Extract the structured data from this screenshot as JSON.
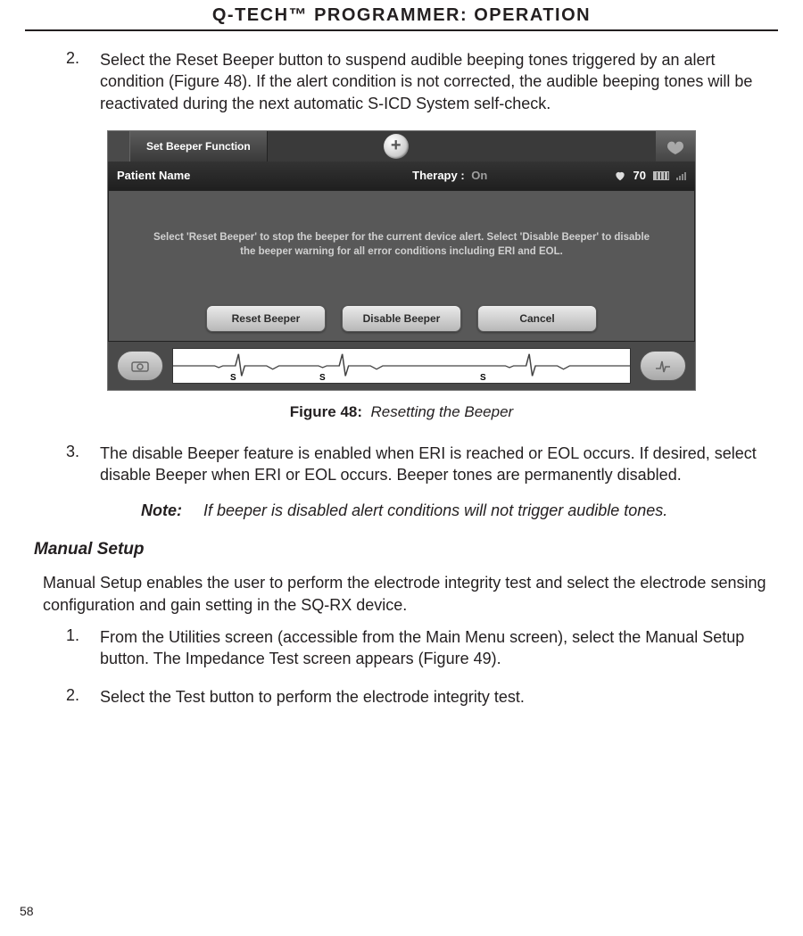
{
  "header": {
    "title": "Q-TECH™ PROGRAMMER:  OPERATION"
  },
  "step2": {
    "num": "2.",
    "text": "Select the Reset Beeper button to suspend audible beeping tones triggered by an alert condition (Figure 48). If the alert condition is not corrected, the audible beeping tones will be reactivated during the next automatic S-ICD System self-check."
  },
  "device": {
    "tab": "Set Beeper Function",
    "patient": "Patient Name",
    "therapy_label": "Therapy :",
    "therapy_value": "On",
    "hr": "70",
    "instruction": "Select 'Reset Beeper' to stop the beeper for the current device alert. Select 'Disable Beeper' to disable the beeper warning for all error conditions including ERI and EOL.",
    "btn_reset": "Reset Beeper",
    "btn_disable": "Disable Beeper",
    "btn_cancel": "Cancel",
    "s1": "S",
    "s2": "S",
    "s3": "S"
  },
  "figcaption": {
    "bold": "Figure 48:",
    "italic": "Resetting the Beeper"
  },
  "step3": {
    "num": "3.",
    "text": "The disable Beeper feature is enabled when ERI is reached or EOL occurs. If desired, select disable Beeper when ERI or EOL occurs. Beeper tones are permanently disabled."
  },
  "note": {
    "label": "Note:",
    "text": "If beeper is disabled alert conditions will not trigger audible tones."
  },
  "manual": {
    "heading": "Manual Setup",
    "intro": "Manual Setup enables the user to perform the electrode integrity test and select the electrode sensing configuration and gain setting in the SQ-RX device.",
    "s1num": "1.",
    "s1text": "From the Utilities screen (accessible from the Main Menu screen), select the Manual Setup button. The Impedance Test screen appears (Figure 49).",
    "s2num": "2.",
    "s2text": "Select the Test button to perform the electrode integrity test."
  },
  "pagenum": "58"
}
